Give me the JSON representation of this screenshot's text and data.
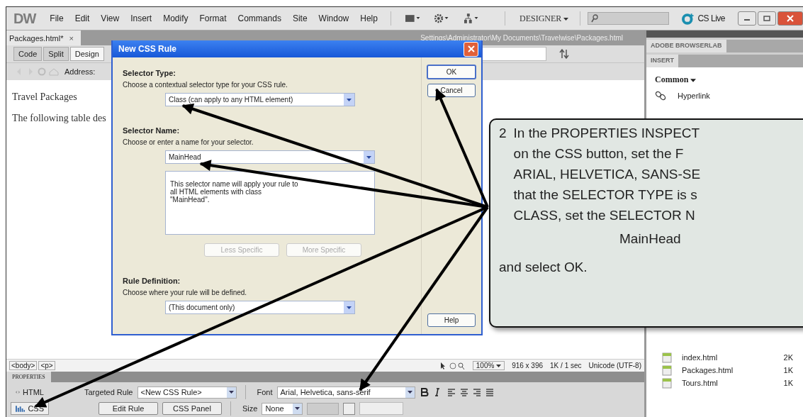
{
  "app": {
    "logo": "DW",
    "menus": [
      "File",
      "Edit",
      "View",
      "Insert",
      "Modify",
      "Format",
      "Commands",
      "Site",
      "Window",
      "Help"
    ],
    "workspace": "DESIGNER",
    "cs_live": "CS Live"
  },
  "document": {
    "tab": {
      "label": "Packages.html*",
      "close": "×"
    },
    "path": "Settings\\Administrator\\My Documents\\Travelwise\\Packages.html",
    "view_buttons": [
      {
        "label": "Code",
        "selected": false
      },
      {
        "label": "Split",
        "selected": false
      },
      {
        "label": "Design",
        "selected": true
      }
    ],
    "address_label": "Address:",
    "content": [
      "Travel Packages",
      "The following table des"
    ],
    "tag_selector": [
      "<body>",
      "<p>"
    ],
    "status": {
      "zoom": "100%",
      "size": "916 x 396",
      "download": "1K / 1 sec",
      "encoding": "Unicode (UTF-8)"
    }
  },
  "properties": {
    "title": "PROPERTIES",
    "modes": [
      {
        "label": "HTML",
        "selected": false
      },
      {
        "label": "CSS",
        "selected": true
      }
    ],
    "targeted_rule_label": "Targeted Rule",
    "targeted_rule": "<New CSS Rule>",
    "edit_rule": "Edit Rule",
    "css_panel": "CSS Panel",
    "font_label": "Font",
    "font": "Arial, Helvetica, sans-serif",
    "size_label": "Size",
    "size": "None"
  },
  "side_panel": {
    "browserlab": "ADOBE BROWSERLAB",
    "insert": "INSERT",
    "category": "Common",
    "insert_items": [
      "Hyperlink"
    ],
    "files": [
      {
        "name": "index.html",
        "size": "2K"
      },
      {
        "name": "Packages.html",
        "size": "1K"
      },
      {
        "name": "Tours.html",
        "size": "1K"
      }
    ]
  },
  "dialog": {
    "title": "New CSS Rule",
    "sections": [
      {
        "heading": "Selector Type:",
        "hint": "Choose a contextual selector type for your CSS rule.",
        "value": "Class (can apply to any HTML element)"
      },
      {
        "heading": "Selector Name:",
        "hint": "Choose or enter a name for your selector.",
        "value": "MainHead",
        "description": "This selector name will apply your rule to all HTML elements with class \"MainHead\".",
        "buttons": [
          {
            "label": "Less Specific",
            "disabled": true
          },
          {
            "label": "More Specific",
            "disabled": true
          }
        ]
      },
      {
        "heading": "Rule Definition:",
        "hint": "Choose where your rule will be defined.",
        "value": "(This document only)"
      }
    ],
    "buttons": [
      "OK",
      "Cancel",
      "Help"
    ]
  },
  "callout": {
    "number": "2",
    "lines": [
      "In the PROPERTIES INSPECT",
      "on the CSS button, set the F",
      "ARIAL, HELVETICA, SANS-SE",
      "that the SELECTOR TYPE is s",
      "CLASS, set the SELECTOR N"
    ],
    "code": "MainHead",
    "end": "and select OK."
  }
}
